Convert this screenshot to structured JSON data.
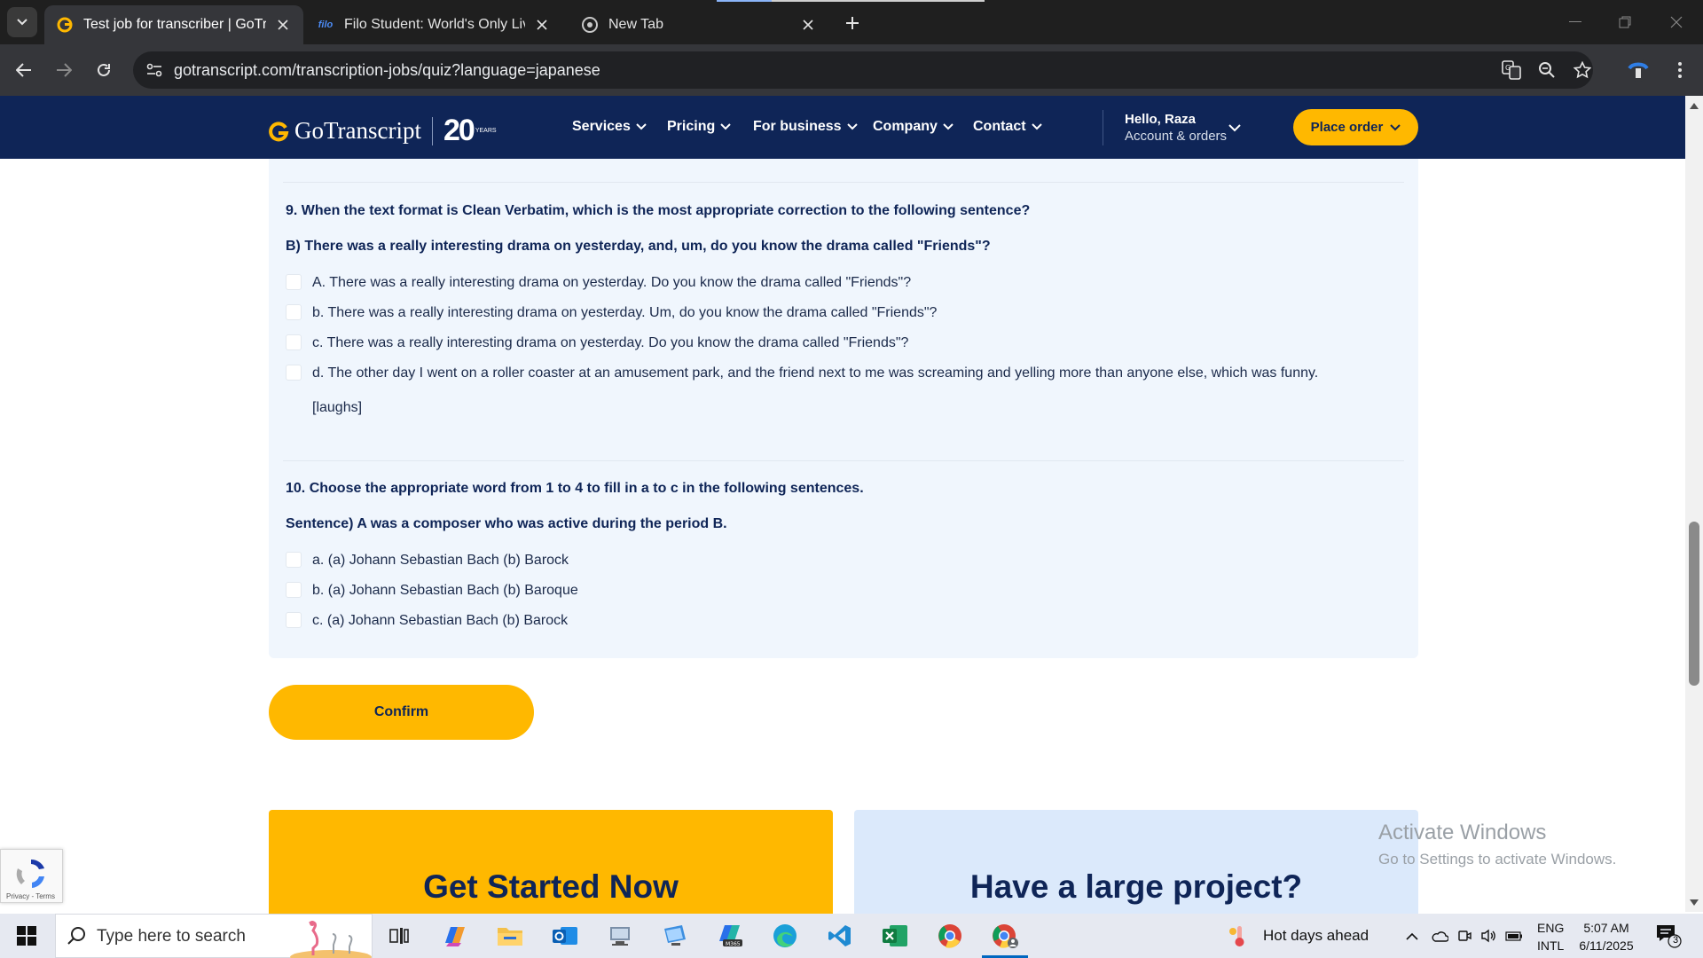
{
  "browser": {
    "tabs": [
      {
        "title": "Test job for transcriber | GoTran",
        "active": true
      },
      {
        "title": "Filo Student: World's Only Live I",
        "active": false
      },
      {
        "title": "New Tab",
        "active": false
      }
    ],
    "url": "gotranscript.com/transcription-jobs/quiz?language=japanese"
  },
  "site": {
    "logo": "GoTranscript",
    "anniversary": "20",
    "anniversary_sub": "YEARS",
    "nav": [
      "Services",
      "Pricing",
      "For business",
      "Company",
      "Contact"
    ],
    "greeting": "Hello, Raza",
    "account_link": "Account & orders",
    "place_order": "Place order"
  },
  "quiz": {
    "q9": {
      "title": "9. When the text format is Clean Verbatim, which is the most appropriate correction to the following sentence?",
      "prompt": "B) There was a really interesting drama on yesterday, and, um, do you know the drama called \"Friends\"?",
      "options": [
        "A. There was a really interesting drama on yesterday. Do you know the drama called \"Friends\"?",
        "b. There was a really interesting drama on yesterday. Um, do you know the drama called \"Friends\"?",
        "c. There was a really interesting drama on yesterday. Do you know the drama called \"Friends\"?",
        "d. The other day I went on a roller coaster at an amusement park, and the friend next to me was screaming and yelling more than anyone else, which was funny."
      ],
      "option_d_continued": "[laughs]"
    },
    "q10": {
      "title": "10. Choose the appropriate word from 1 to 4 to fill in a to c in the following sentences.",
      "prompt": "Sentence) A was a composer who was active during the period B.",
      "options": [
        "a. (a) Johann Sebastian Bach (b) Barock",
        "b. (a) Johann Sebastian Bach (b) Baroque",
        "c. (a) Johann Sebastian Bach (b) Barock"
      ]
    },
    "confirm_label": "Confirm"
  },
  "cards": {
    "left_title": "Get Started Now",
    "right_title": "Have a large project?"
  },
  "recaptcha": {
    "links": "Privacy - Terms"
  },
  "watermark": {
    "line1": "Activate Windows",
    "line2": "Go to Settings to activate Windows."
  },
  "taskbar": {
    "search_placeholder": "Type here to search",
    "weather": "Hot days ahead",
    "lang_line1": "ENG",
    "lang_line2": "INTL",
    "time": "5:07 AM",
    "date": "6/11/2025",
    "notification_count": "3",
    "apps": [
      "task-view",
      "copilot",
      "file-explorer",
      "outlook",
      "network-app",
      "desktop-app",
      "m365",
      "edge",
      "vscode",
      "excel",
      "chrome",
      "chrome-profile"
    ]
  },
  "colors": {
    "brand_navy": "#0f2557",
    "brand_yellow": "#ffb800",
    "panel_bg": "#f0f6fd",
    "card_blue": "#dbe9fb"
  }
}
